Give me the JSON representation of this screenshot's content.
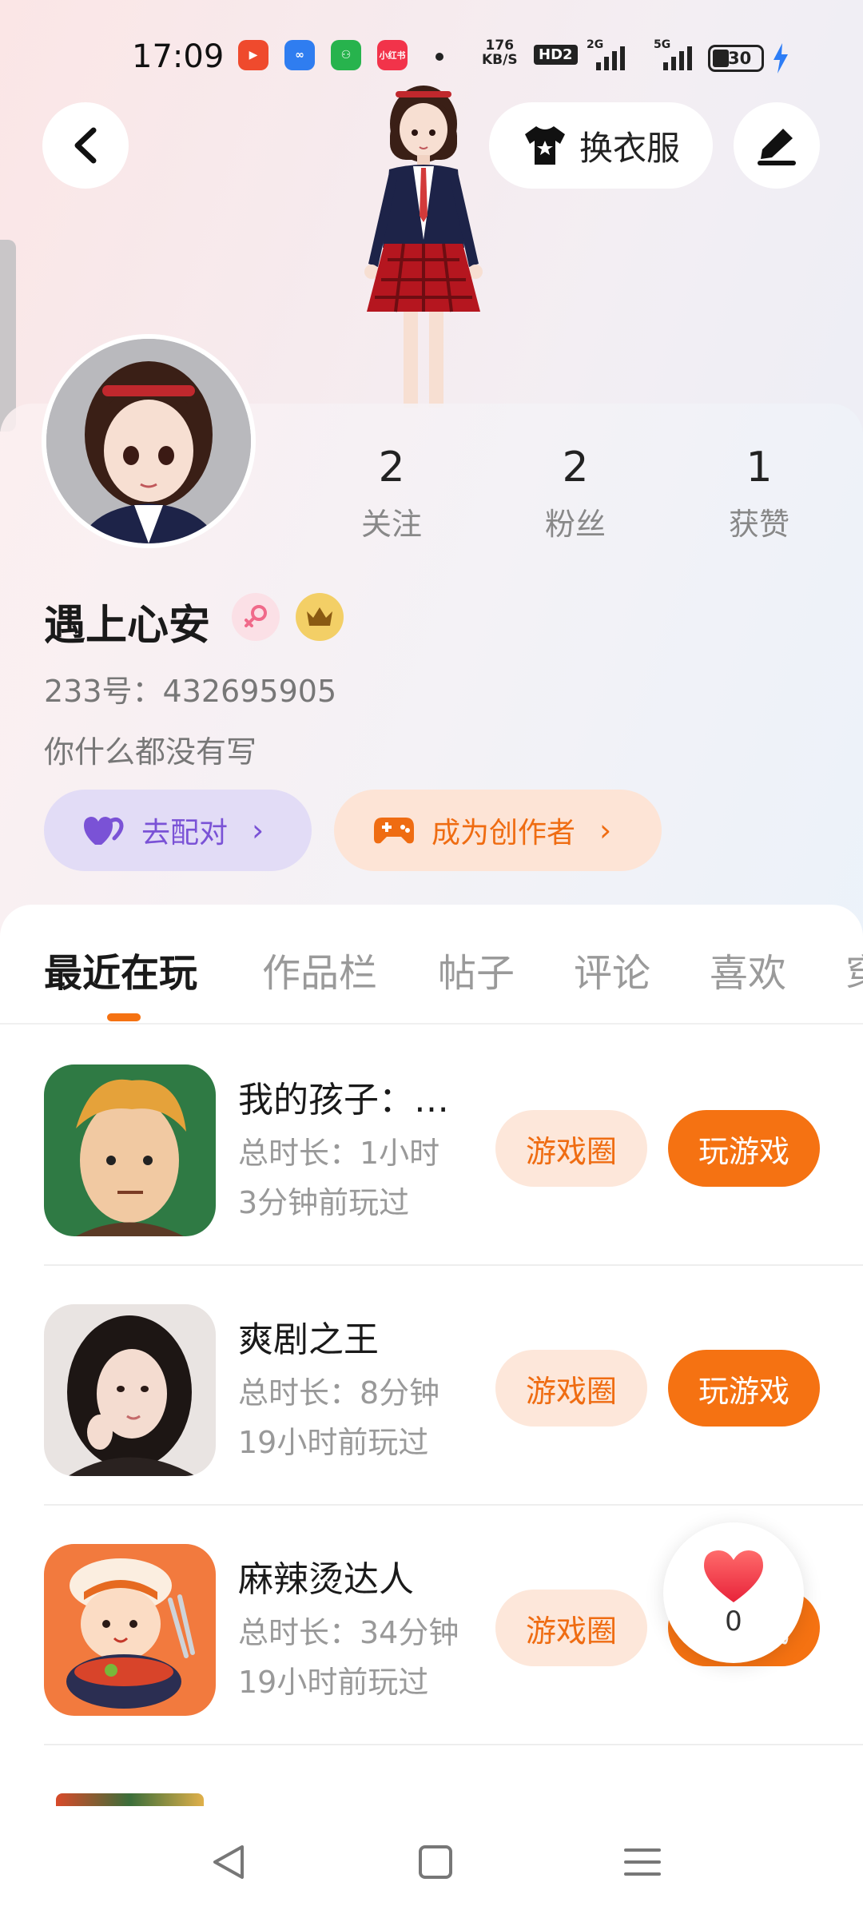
{
  "status_bar": {
    "time": "17:09",
    "net_speed_value": "176",
    "net_speed_unit": "KB/S",
    "hd": "HD2",
    "signal1_label": "2G",
    "signal2_label": "5G",
    "battery": "30",
    "app_icons": [
      "video-app-icon",
      "infinity-app-icon",
      "green-app-icon",
      "xiaohongshu-icon"
    ]
  },
  "header": {
    "outfit_button": "换衣服"
  },
  "profile": {
    "stats": [
      {
        "value": "2",
        "label": "关注"
      },
      {
        "value": "2",
        "label": "粉丝"
      },
      {
        "value": "1",
        "label": "获赞"
      }
    ],
    "username": "遇上心安",
    "user_id": "233号：432695905",
    "bio": "你什么都没有写",
    "match_button": "去配对",
    "creator_button": "成为创作者"
  },
  "tabs": [
    "最近在玩",
    "作品栏",
    "帖子",
    "评论",
    "喜欢",
    "穿"
  ],
  "games": [
    {
      "name": "我的孩子：…",
      "duration": "总时长：1小时",
      "last_played": "3分钟前玩过",
      "circle_btn": "游戏圈",
      "play_btn": "玩游戏"
    },
    {
      "name": "爽剧之王",
      "duration": "总时长：8分钟",
      "last_played": "19小时前玩过",
      "circle_btn": "游戏圈",
      "play_btn": "玩游戏"
    },
    {
      "name": "麻辣烫达人",
      "duration": "总时长：34分钟",
      "last_played": "19小时前玩过",
      "circle_btn": "游戏圈",
      "play_btn": "玩游戏"
    }
  ],
  "like_float": {
    "count": "0"
  },
  "colors": {
    "accent": "#f57212",
    "purple": "#7a52d6",
    "light_orange": "#fde7da"
  }
}
